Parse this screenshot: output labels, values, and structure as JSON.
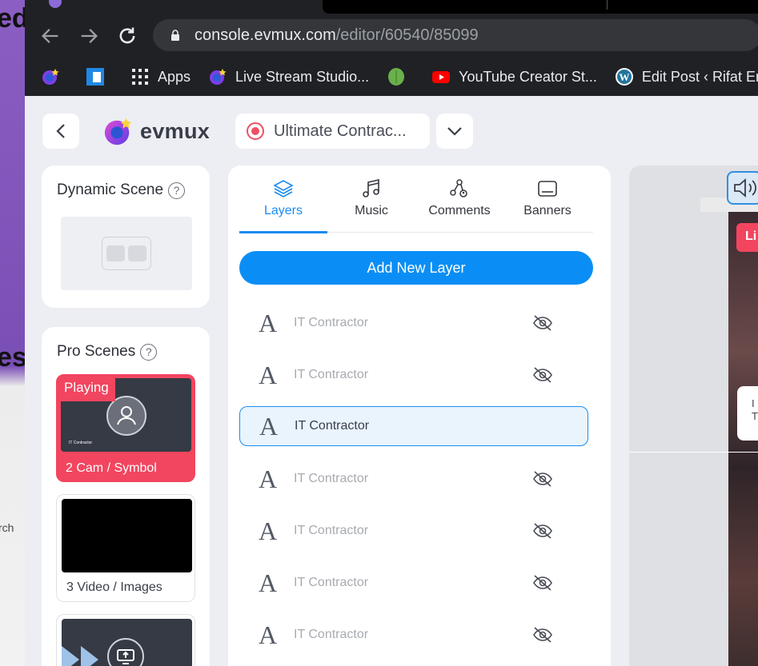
{
  "browser": {
    "url_host": "console.evmux.com",
    "url_path": "/editor/60540/85099",
    "bookmarks": [
      {
        "label": "",
        "icon": "evmux-icon"
      },
      {
        "label": "",
        "icon": "blue-square-icon"
      },
      {
        "label": "Apps",
        "icon": "apps-grid-icon"
      },
      {
        "label": "Live Stream Studio...",
        "icon": "evmux-icon"
      },
      {
        "label": "",
        "icon": "leaf-icon"
      },
      {
        "label": "YouTube Creator St...",
        "icon": "youtube-icon"
      },
      {
        "label": "Edit Post ‹ Rifat Erd...",
        "icon": "wordpress-icon"
      }
    ]
  },
  "background_fragments": {
    "top": "ed",
    "middle": "es",
    "side_text": "rch"
  },
  "header": {
    "logo_text": "evmux",
    "scene_name": "Ultimate Contrac..."
  },
  "dynamic_scene": {
    "title": "Dynamic Scene",
    "help": "?"
  },
  "pro_scenes": {
    "title": "Pro Scenes",
    "help": "?",
    "items": [
      {
        "label": "2 Cam / Symbol",
        "badge": "Playing",
        "thumb_caption": "IT Contractor"
      },
      {
        "label": "3 Video / Images"
      },
      {
        "label": ""
      }
    ]
  },
  "tabs": [
    {
      "label": "Layers",
      "icon": "layers-icon",
      "active": true
    },
    {
      "label": "Music",
      "icon": "music-icon",
      "active": false
    },
    {
      "label": "Comments",
      "icon": "comments-icon",
      "active": false
    },
    {
      "label": "Banners",
      "icon": "banner-icon",
      "active": false
    }
  ],
  "add_layer_label": "Add New Layer",
  "layers": [
    {
      "glyph": "A",
      "name": "IT Contractor",
      "selected": false
    },
    {
      "glyph": "A",
      "name": "IT Contractor",
      "selected": false
    },
    {
      "glyph": "A",
      "name": "IT Contractor",
      "selected": true
    },
    {
      "glyph": "A",
      "name": "IT Contractor",
      "selected": false
    },
    {
      "glyph": "A",
      "name": "IT Contractor",
      "selected": false
    },
    {
      "glyph": "A",
      "name": "IT Contractor",
      "selected": false
    },
    {
      "glyph": "A",
      "name": "IT Contractor",
      "selected": false
    }
  ],
  "preview": {
    "live_label": "Li",
    "card_text_1": "I",
    "card_text_2": "T"
  },
  "colors": {
    "accent": "#1a8cf0",
    "live_red": "#f2455f",
    "app_bg": "#eceef3"
  }
}
